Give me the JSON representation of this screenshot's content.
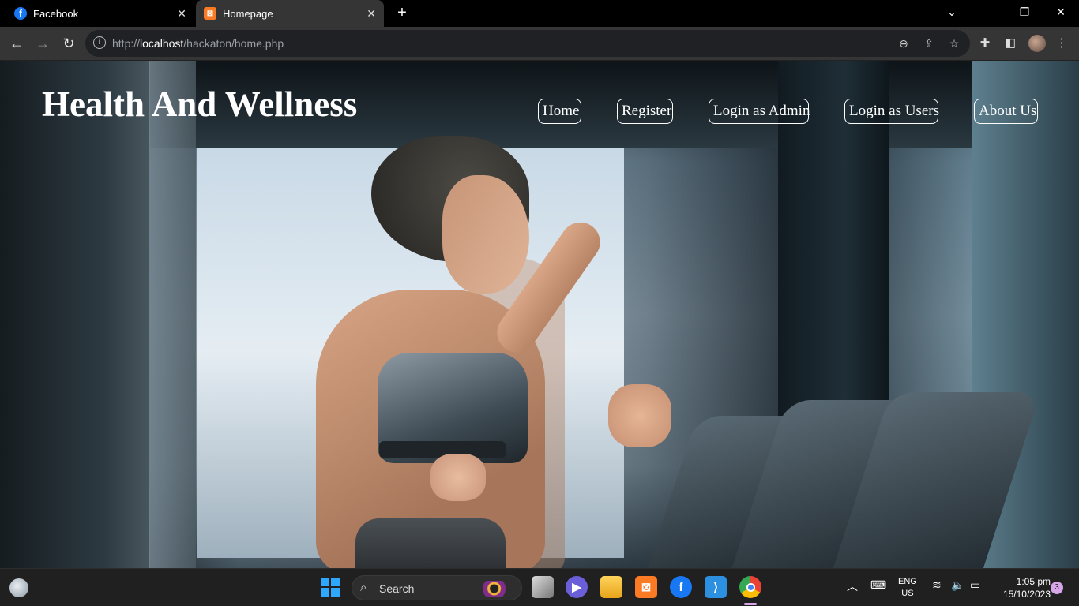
{
  "browser": {
    "tabs": [
      {
        "title": "Facebook",
        "icon": "facebook-icon",
        "active": false
      },
      {
        "title": "Homepage",
        "icon": "xampp-icon",
        "active": true
      }
    ],
    "new_tab_symbol": "+",
    "address": {
      "scheme": "http://",
      "host": "localhost",
      "path": "/hackaton/home.php"
    }
  },
  "site": {
    "title": "Health And Wellness",
    "nav": [
      "Home",
      "Register",
      "Login as Admin",
      "Login as Users",
      "About Us"
    ],
    "hero_image": "woman running on treadmill in gym"
  },
  "taskbar": {
    "search_label": "Search",
    "apps": [
      "file-explorer-icon",
      "teams-icon",
      "folder-icon",
      "xampp-icon",
      "facebook-icon",
      "vscode-icon",
      "chrome-icon"
    ],
    "language": {
      "line1": "ENG",
      "line2": "US"
    },
    "time": "1:05 pm",
    "date": "15/10/2023",
    "notification_count": "3"
  },
  "colors": {
    "facebook_blue": "#1877f2",
    "xampp_orange": "#fb7a24",
    "windows_blue": "#2ea8ff",
    "vscode_blue": "#2c8fe0"
  }
}
